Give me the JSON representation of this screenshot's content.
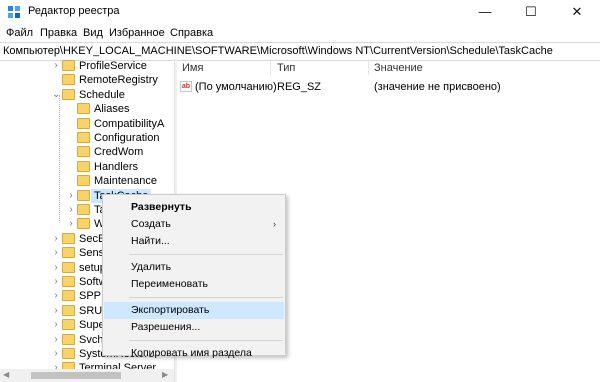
{
  "window": {
    "title": "Редактор реестра",
    "minimize": "—",
    "maximize": "☐",
    "close": "✕"
  },
  "menu": [
    "Файл",
    "Правка",
    "Вид",
    "Избранное",
    "Справка"
  ],
  "address": "Компьютер\\HKEY_LOCAL_MACHINE\\SOFTWARE\\Microsoft\\Windows NT\\CurrentVersion\\Schedule\\TaskCache",
  "tree": [
    {
      "label": "ProfileService",
      "depth": 0,
      "expander": "›"
    },
    {
      "label": "RemoteRegistry",
      "depth": 0,
      "expander": ""
    },
    {
      "label": "Schedule",
      "depth": 0,
      "expander": "⌄"
    },
    {
      "label": "Aliases",
      "depth": 1,
      "expander": ""
    },
    {
      "label": "CompatibilityA",
      "depth": 1,
      "expander": ""
    },
    {
      "label": "Configuration",
      "depth": 1,
      "expander": ""
    },
    {
      "label": "CredWom",
      "depth": 1,
      "expander": ""
    },
    {
      "label": "Handlers",
      "depth": 1,
      "expander": ""
    },
    {
      "label": "Maintenance",
      "depth": 1,
      "expander": ""
    },
    {
      "label": "TaskCache",
      "depth": 1,
      "expander": "›",
      "selected": true
    },
    {
      "label": "Ta",
      "depth": 1,
      "expander": "›"
    },
    {
      "label": "W",
      "depth": 1,
      "expander": "›"
    },
    {
      "label": "SecEd",
      "depth": 0,
      "expander": "›"
    },
    {
      "label": "Senso",
      "depth": 0,
      "expander": "›"
    },
    {
      "label": "setup",
      "depth": 0,
      "expander": "›"
    },
    {
      "label": "Softw",
      "depth": 0,
      "expander": "›"
    },
    {
      "label": "SPP",
      "depth": 0,
      "expander": "›"
    },
    {
      "label": "SRUM",
      "depth": 0,
      "expander": "›"
    },
    {
      "label": "Super",
      "depth": 0,
      "expander": "›"
    },
    {
      "label": "Svcho",
      "depth": 0,
      "expander": "›"
    },
    {
      "label": "SystemRestore",
      "depth": 0,
      "expander": "›"
    },
    {
      "label": "Terminal Server",
      "depth": 0,
      "expander": "›"
    }
  ],
  "columns": {
    "name": "Имя",
    "type": "Тип",
    "value": "Значение"
  },
  "values": [
    {
      "icon": "ab",
      "name": "(По умолчанию)",
      "type": "REG_SZ",
      "data": "(значение не присвоено)"
    }
  ],
  "context_menu": [
    {
      "label": "Развернуть",
      "bold": true
    },
    {
      "label": "Создать",
      "submenu": "›"
    },
    {
      "label": "Найти..."
    },
    {
      "separator": true
    },
    {
      "label": "Удалить"
    },
    {
      "label": "Переименовать"
    },
    {
      "separator": true
    },
    {
      "label": "Экспортировать",
      "highlighted": true
    },
    {
      "label": "Разрешения..."
    },
    {
      "separator": true
    },
    {
      "label": "Копировать имя раздела"
    }
  ],
  "colors": {
    "folder": "#f6d36b",
    "selection": "#cce8ff",
    "menu_highlight": "#cde8ff"
  }
}
